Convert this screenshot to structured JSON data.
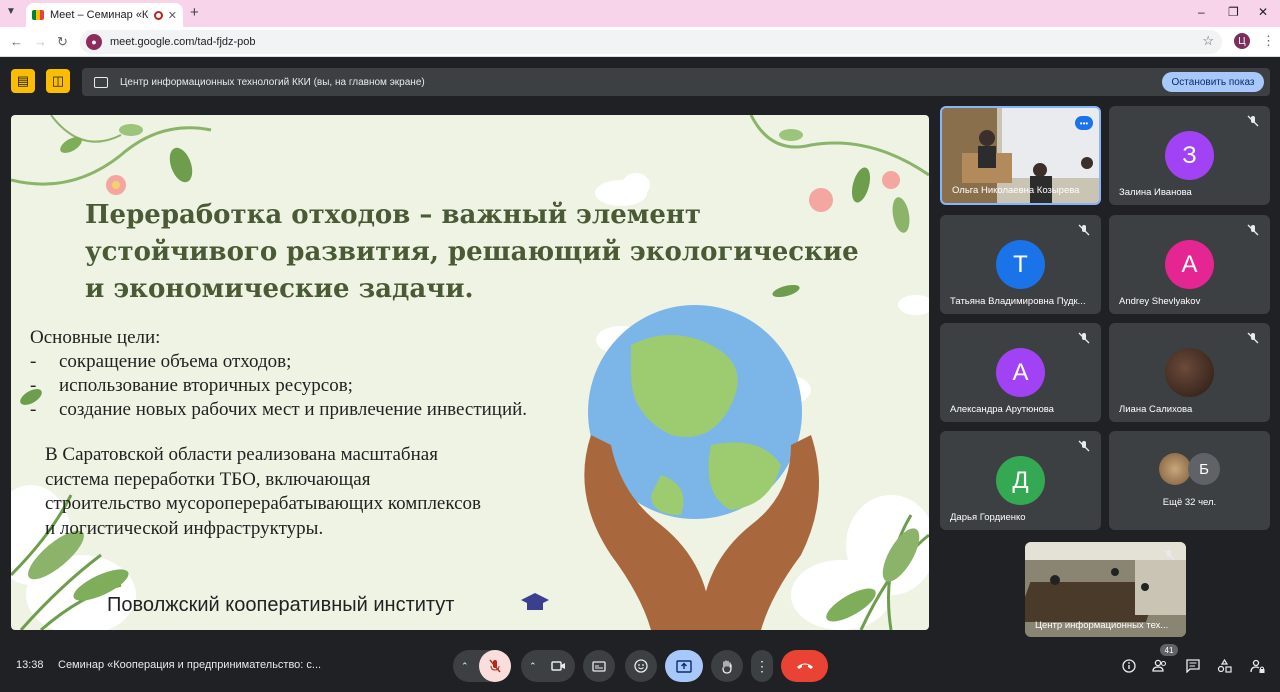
{
  "browser": {
    "tab_title": "Meet – Семинар «Коопера",
    "url": "meet.google.com/tad-fjdz-pob",
    "profile_initial": "Ц"
  },
  "presentation_bar": {
    "text": "Центр информационных технологий ККИ (вы, на главном экране)",
    "stop_label": "Остановить показ"
  },
  "slide": {
    "title_lines": [
      "Переработка отходов – важный элемент",
      "устойчивого развития, решающий экологические",
      "и экономические задачи."
    ],
    "goals_heading": "Основные цели:",
    "goals": [
      "сокращение объема отходов;",
      "использование вторичных ресурсов;",
      "создание новых рабочих мест и привлечение инвестиций."
    ],
    "goal_bullet": "-",
    "region_lines": [
      "В Саратовской области реализована масштабная",
      "система переработки ТБО, включающая",
      "строительство мусороперерабатывающих комплексов",
      "и логистической инфраструктуры."
    ],
    "org": "Поволжский кооперативный институт"
  },
  "participants": [
    {
      "name": "Ольга Николаевна Козырева",
      "video": true
    },
    {
      "name": "Залина Иванова",
      "initial": "З",
      "color": "#a142f4",
      "muted": true
    },
    {
      "name": "Татьяна Владимировна Пудк...",
      "initial": "Т",
      "color": "#1a73e8",
      "muted": true
    },
    {
      "name": "Andrey Shevlyakov",
      "initial": "А",
      "color": "#e52592",
      "muted": true
    },
    {
      "name": "Александра Арутюнова",
      "initial": "А",
      "color": "#a142f4",
      "muted": true
    },
    {
      "name": "Лиана Салихова",
      "muted": true
    },
    {
      "name": "Дарья Гордиенко",
      "initial": "Д",
      "color": "#34a853",
      "muted": true
    },
    {
      "name": "Ещё 32 чел.",
      "initial": "Б"
    }
  ],
  "self_tile": {
    "name": "Центр информационных тех..."
  },
  "bottom": {
    "time": "13:38",
    "meeting_name": "Семинар «Кооперация и предпринимательство: с...",
    "people_count": "41"
  },
  "colors": {
    "end_call": "#ea4335",
    "accent_blue": "#a8c7fa",
    "mic_off": "#f9dedc"
  }
}
